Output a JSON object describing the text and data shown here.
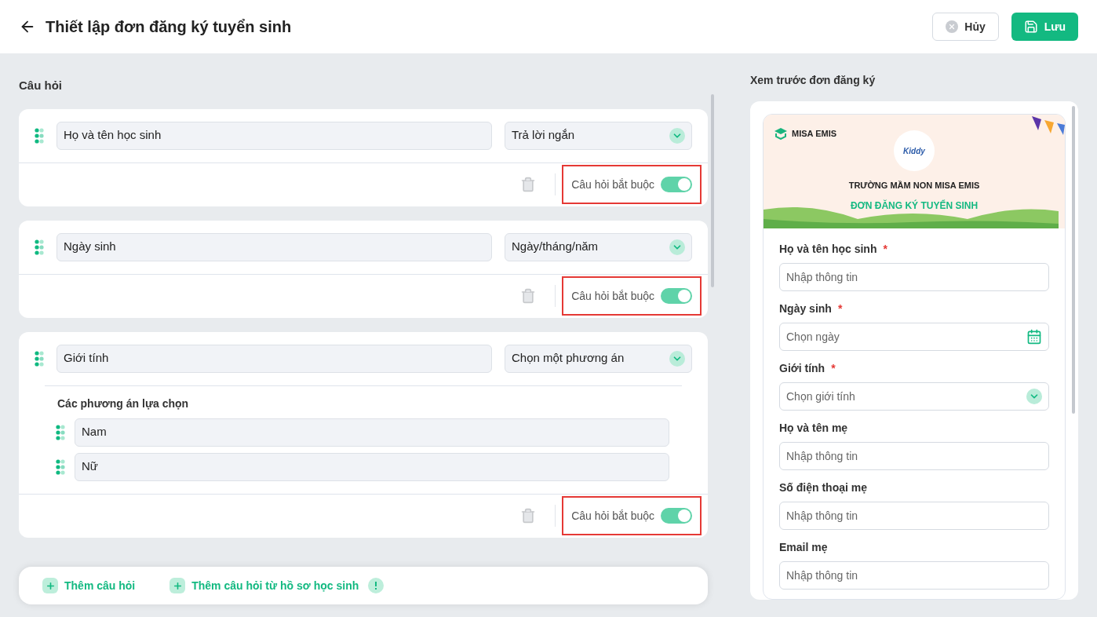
{
  "header": {
    "title": "Thiết lập đơn đăng ký tuyển sinh",
    "buttons": [
      {
        "kind": "cancel",
        "label": "Hủy"
      },
      {
        "kind": "save",
        "label": "Lưu"
      }
    ]
  },
  "questions_title": "Câu hỏi",
  "questions": [
    {
      "name": "Họ và tên học sinh",
      "type": "Trả lời ngắn",
      "required_label": "Câu hỏi bắt buộc",
      "required": true,
      "highlighted": true
    },
    {
      "name": "Ngày sinh",
      "type": "Ngày/tháng/năm",
      "required_label": "Câu hỏi bắt buộc",
      "required": true,
      "highlighted": true
    },
    {
      "name": "Giới tính",
      "type": "Chọn một phương án",
      "options_title": "Các phương án lựa chọn",
      "options": [
        "Nam",
        "Nữ"
      ],
      "required_label": "Câu hỏi bắt buộc",
      "required": true,
      "highlighted": true
    }
  ],
  "add_actions": [
    "Thêm câu hỏi",
    "Thêm câu hỏi từ hồ sơ học sinh"
  ],
  "preview": {
    "title": "Xem trước đơn đăng ký",
    "brand": "MISA EMIS",
    "logo_text": "Kiddy",
    "school": "TRƯỜNG MẦM NON MISA EMIS",
    "form_title": "ĐƠN ĐĂNG KÝ TUYỂN SINH",
    "fields": [
      {
        "kind": "text",
        "label": "Họ và tên học sinh",
        "required_mark": "*",
        "placeholder": "Nhập thông tin"
      },
      {
        "kind": "date",
        "label": "Ngày sinh",
        "required_mark": "*",
        "placeholder": "Chọn ngày"
      },
      {
        "kind": "select",
        "label": "Giới tính",
        "required_mark": "*",
        "placeholder": "Chọn giới tính"
      },
      {
        "kind": "text",
        "label": "Họ và tên mẹ",
        "placeholder": "Nhập thông tin"
      },
      {
        "kind": "text",
        "label": "Số điện thoại mẹ",
        "placeholder": "Nhập thông tin"
      },
      {
        "kind": "text",
        "label": "Email mẹ",
        "placeholder": "Nhập thông tin"
      }
    ]
  }
}
